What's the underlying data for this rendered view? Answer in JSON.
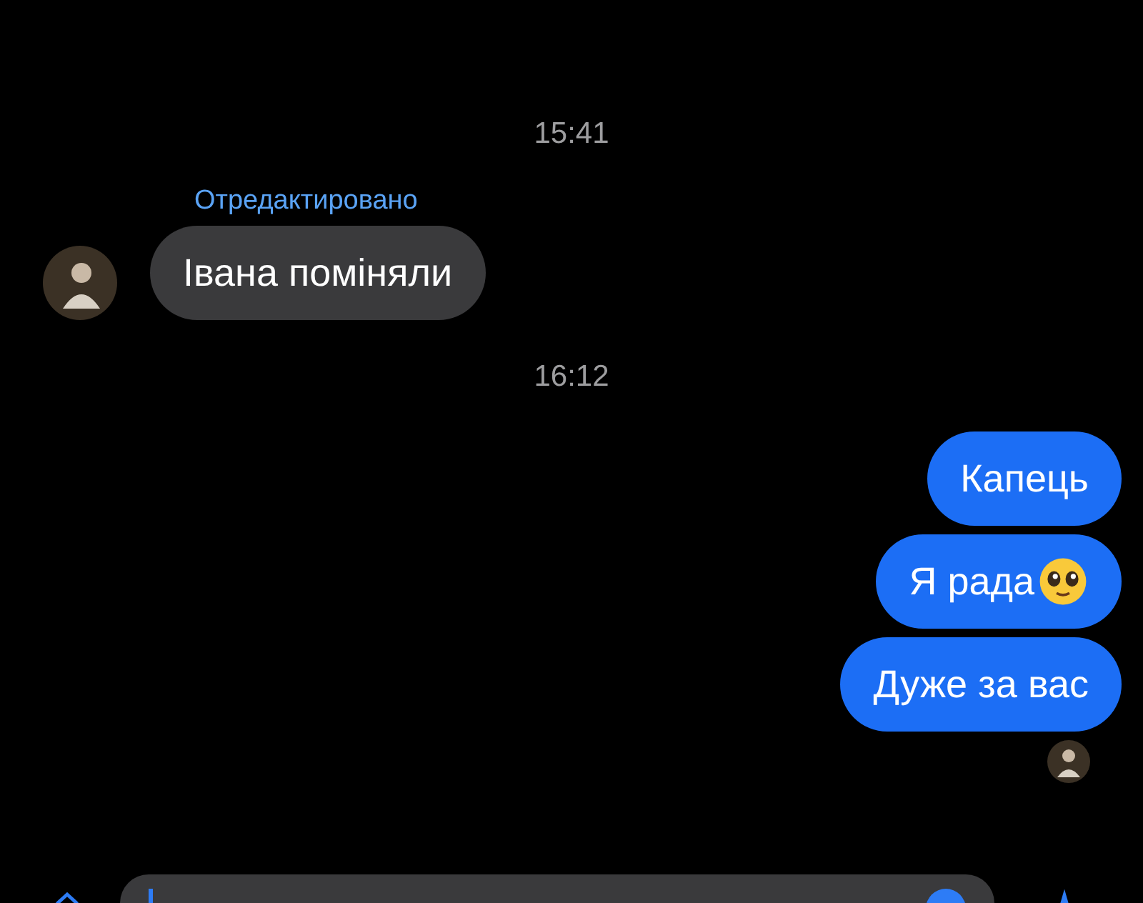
{
  "messages": [
    {
      "kind": "time",
      "text": "15:41"
    },
    {
      "kind": "incoming",
      "text": "Івана поміняли",
      "edited_label": "Отредактировано",
      "avatar": true
    },
    {
      "kind": "time",
      "text": "16:12"
    },
    {
      "kind": "outgoing",
      "text": "Капець",
      "emoji": false
    },
    {
      "kind": "outgoing",
      "text": "Я рада",
      "emoji": true
    },
    {
      "kind": "outgoing",
      "text": "Дуже за вас",
      "emoji": false,
      "read_avatar": true
    }
  ]
}
